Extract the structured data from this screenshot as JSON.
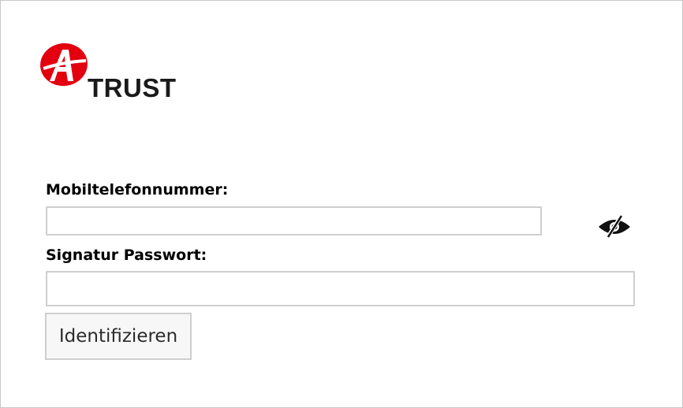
{
  "brand": {
    "logo_text": "TRUST",
    "logo_mark_text": "A",
    "logo_color": "#e3000f"
  },
  "form": {
    "phone_label": "Mobiltelefonnummer:",
    "phone_value": "",
    "password_label": "Signatur Passwort:",
    "password_value": "",
    "password_visibility_icon": "eye-slash-icon",
    "submit_label": "Identifizieren"
  },
  "colors": {
    "border": "#cfcfcf",
    "button_bg": "#f7f7f7",
    "text": "#000000"
  }
}
